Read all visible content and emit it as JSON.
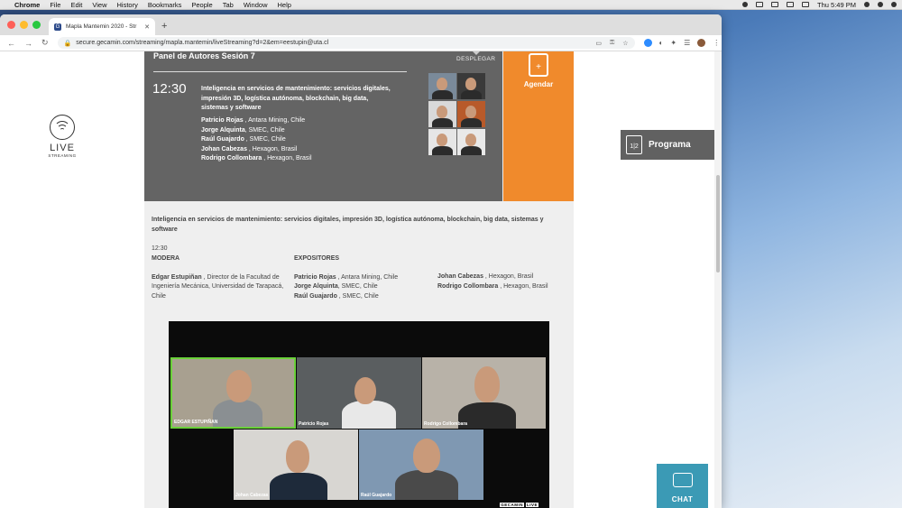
{
  "menubar": {
    "app": "Chrome",
    "items": [
      "File",
      "Edit",
      "View",
      "History",
      "Bookmarks",
      "People",
      "Tab",
      "Window",
      "Help"
    ],
    "clock": "Thu 5:49 PM"
  },
  "browser": {
    "tab_title": "Mapla Mantemin 2020 - Str",
    "tab_favicon": "G",
    "url": "secure.gecamin.com/streaming/mapla.mantemin/liveStreaming?d=2&em=eestupin@uta.cl"
  },
  "sidebar_logo": {
    "line1": "LIVE",
    "line2": "STREAMING"
  },
  "panel": {
    "title": "Panel de Autores Sesión 7",
    "toggle": "DESPLEGAR",
    "time": "12:30",
    "session_title": "Inteligencia en servicios de mantenimiento: servicios digitales, impresión 3D, logística autónoma, blockchain, big data, sistemas y software",
    "people": [
      {
        "name": "Patricio Rojas",
        "org": " , Antara Mining, Chile"
      },
      {
        "name": "Jorge Alquinta",
        "org": ", SMEC, Chile"
      },
      {
        "name": "Raúl Guajardo",
        "org": " , SMEC, Chile"
      },
      {
        "name": "Johan Cabezas",
        "org": " , Hexagon, Brasil"
      },
      {
        "name": "Rodrigo Collombara",
        "org": " , Hexagon, Brasil"
      }
    ]
  },
  "agendar": {
    "label": "Agendar"
  },
  "details": {
    "description": "Inteligencia en servicios de mantenimiento: servicios digitales, impresión 3D, logística autónoma, blockchain, big data, sistemas y software",
    "time": "12:30",
    "modera_heading": "MODERA",
    "moderator": {
      "name": "Edgar Estupiñan",
      "org": " , Director de la Facultad de Ingeniería Mecánica, Universidad de Tarapacá, Chile"
    },
    "expositores_heading": "EXPOSITORES",
    "expositores_col1": [
      {
        "name": "Patricio Rojas",
        "org": " , Antara Mining, Chile"
      },
      {
        "name": "Jorge Alquinta",
        "org": ", SMEC, Chile"
      },
      {
        "name": "Raúl Guajardo",
        "org": " , SMEC, Chile"
      }
    ],
    "expositores_col2": [
      {
        "name": "Johan Cabezas",
        "org": " , Hexagon, Brasil"
      },
      {
        "name": "Rodrigo Collombara",
        "org": " , Hexagon, Brasil"
      }
    ]
  },
  "video": {
    "participants": [
      "EDGAR ESTUPIÑAN",
      "Patricio Rojas",
      "Rodrigo Collombara",
      "Johan Cabezas",
      "Raúl Guajardo"
    ],
    "brand": "GECAMIN",
    "brand_tag": "LIVE"
  },
  "programa": {
    "label": "Programa",
    "icon_text": "1|2"
  },
  "chat": {
    "label": "CHAT"
  }
}
